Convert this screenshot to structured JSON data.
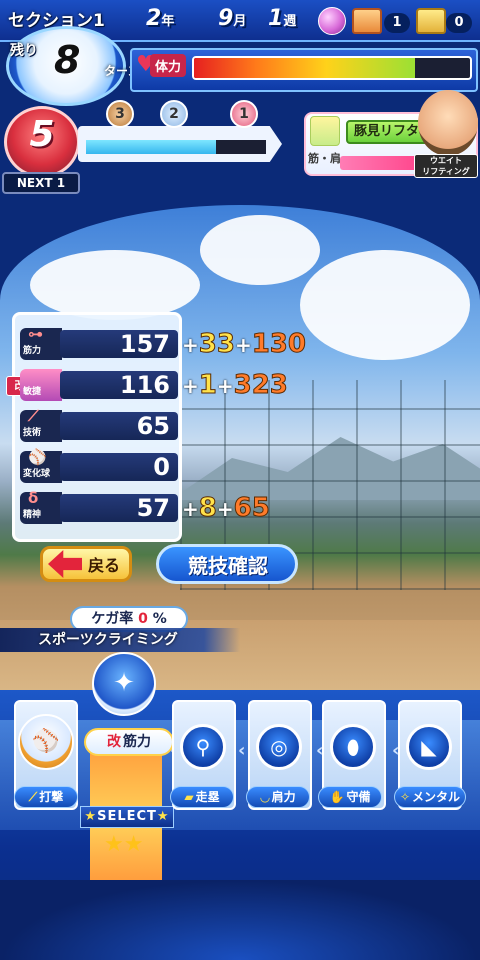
{
  "hud": {
    "section_label": "セクション1",
    "year": "2",
    "year_unit": "年",
    "month": "9",
    "month_unit": "月",
    "week": "1",
    "week_unit": "週",
    "chest_red_count": "1",
    "chest_gold_count": "0",
    "remaining_label": "残り",
    "turns_left": "8",
    "turn_unit": "ターン",
    "stamina_label": "体力",
    "stamina_level": 0.8,
    "rank": "5",
    "next_label": "NEXT 1",
    "medals": [
      "3",
      "2",
      "1"
    ],
    "progress_level": 0.72
  },
  "trainer": {
    "tag": "筋・肩",
    "name": "豚見リフター",
    "role_line1": "ウエイト",
    "role_line2": "リフティング"
  },
  "stats": [
    {
      "name": "筋力",
      "icon": "dumbbell-icon",
      "value": "157",
      "bonus1": "33",
      "bonus2": "130"
    },
    {
      "name": "敏捷",
      "icon": "shoe-icon",
      "value": "116",
      "bonus1": "1",
      "bonus2": "323",
      "modified": "改"
    },
    {
      "name": "技術",
      "icon": "bat-icon",
      "value": "65",
      "bonus1": "",
      "bonus2": ""
    },
    {
      "name": "変化球",
      "icon": "baseball-icon",
      "value": "0",
      "bonus1": "",
      "bonus2": ""
    },
    {
      "name": "精神",
      "icon": "spirit-icon",
      "value": "57",
      "bonus1": "8",
      "bonus2": "65"
    }
  ],
  "buttons": {
    "back": "戻る",
    "confirm": "競技確認"
  },
  "injury": {
    "label": "ケガ率",
    "value": "0",
    "unit": "%"
  },
  "training_name": "スポーツクライミング",
  "menu": {
    "select_label": "SELECT",
    "selected_chip_tag": "改",
    "selected_chip_label": "筋力",
    "categories": [
      {
        "label": "打撃",
        "icon": "bat-icon"
      },
      {
        "label": "走塁",
        "icon": "base-icon"
      },
      {
        "label": "肩力",
        "icon": "arm-icon"
      },
      {
        "label": "守備",
        "icon": "glove-icon"
      },
      {
        "label": "メンタル",
        "icon": "brain-icon"
      }
    ],
    "trainings": [
      {
        "icon": "bicycle-icon"
      },
      {
        "icon": "goggles-icon"
      },
      {
        "icon": "football-icon"
      },
      {
        "icon": "sneaker-icon"
      }
    ]
  }
}
